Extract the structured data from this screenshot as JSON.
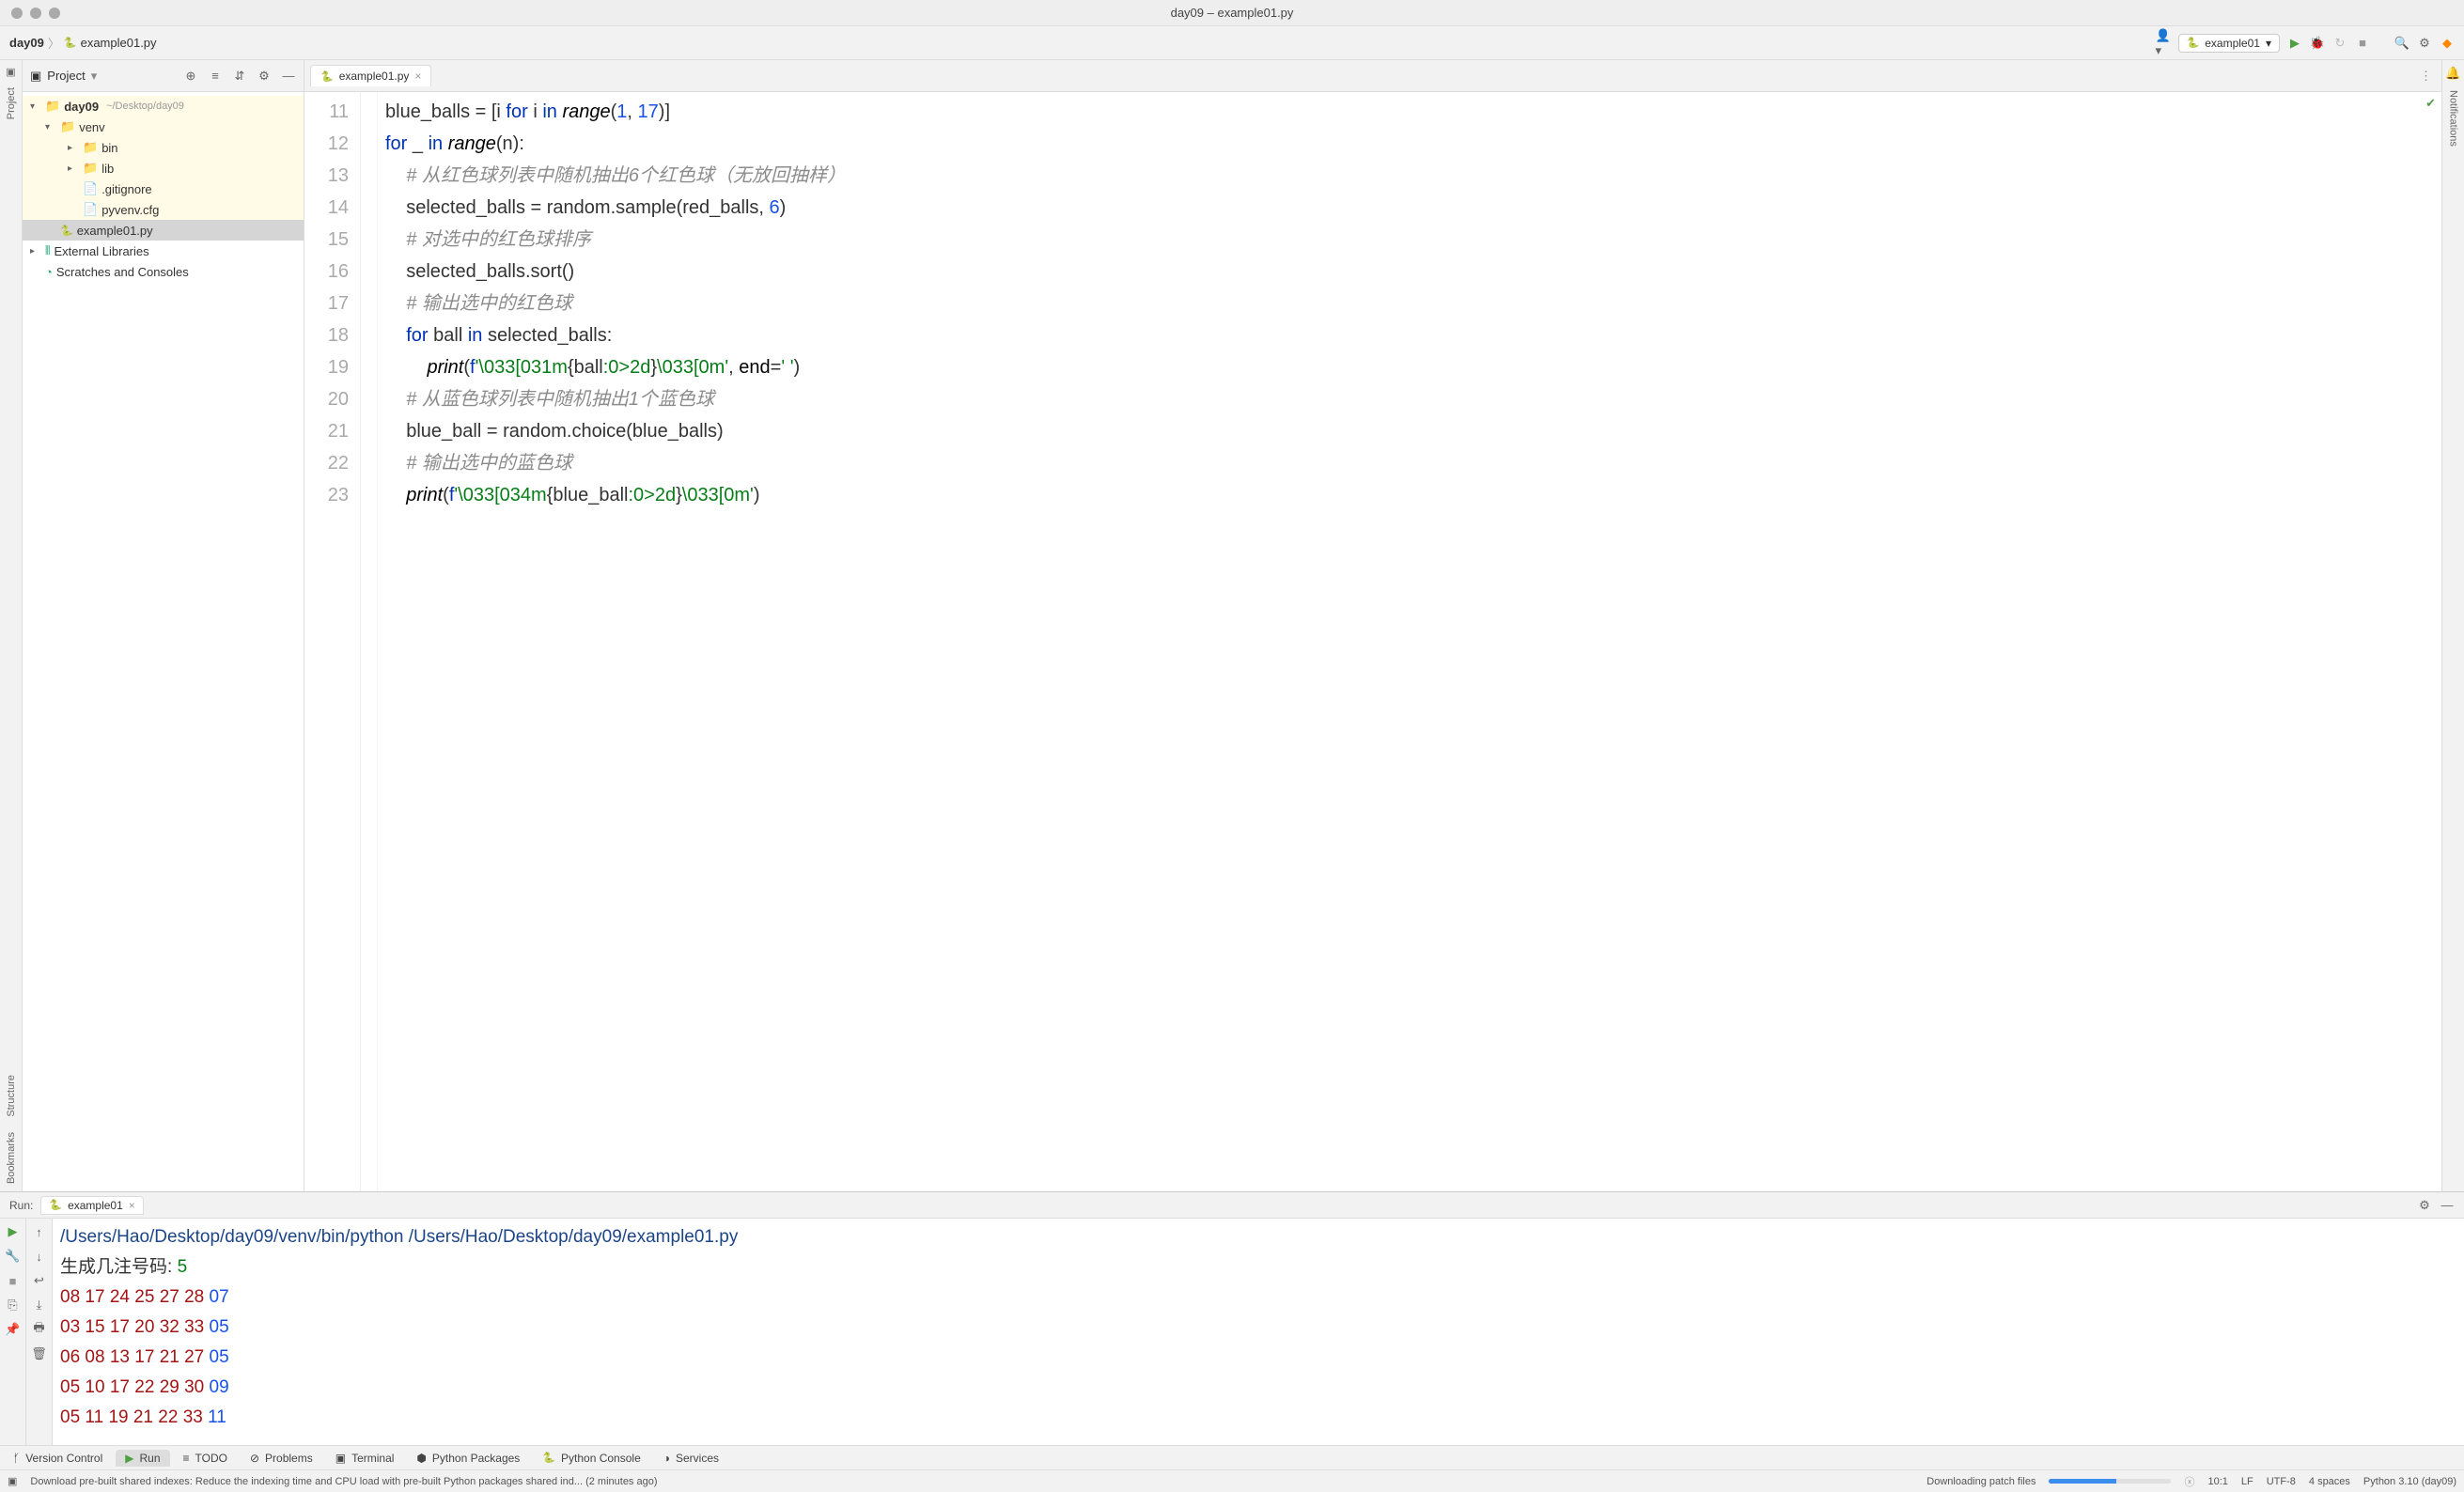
{
  "window": {
    "title": "day09 – example01.py"
  },
  "breadcrumbs": {
    "project": "day09",
    "file": "example01.py"
  },
  "run_config": {
    "selected": "example01"
  },
  "sidebar": {
    "title": "Project",
    "tree": {
      "root": {
        "name": "day09",
        "path": "~/Desktop/day09"
      },
      "venv": "venv",
      "bin": "bin",
      "lib": "lib",
      "gitignore": ".gitignore",
      "pyvenv": "pyvenv.cfg",
      "example": "example01.py",
      "external": "External Libraries",
      "scratches": "Scratches and Consoles"
    }
  },
  "editor": {
    "tab": "example01.py",
    "first_line": 11,
    "lines": [
      {
        "n": 11,
        "html": "blue_balls = [i <span class='kw'>for</span> i <span class='kw'>in</span> <span class='fn'>range</span>(<span class='num'>1</span>, <span class='num'>17</span>)]"
      },
      {
        "n": 12,
        "html": "<span class='kw'>for</span> _ <span class='kw'>in</span> <span class='fn'>range</span>(n):"
      },
      {
        "n": 13,
        "html": "    <span class='cm'># 从红色球列表中随机抽出6个红色球（无放回抽样）</span>"
      },
      {
        "n": 14,
        "html": "    selected_balls = random.sample(red_balls, <span class='num'>6</span>)"
      },
      {
        "n": 15,
        "html": "    <span class='cm'># 对选中的红色球排序</span>"
      },
      {
        "n": 16,
        "html": "    selected_balls.sort()"
      },
      {
        "n": 17,
        "html": "    <span class='cm'># 输出选中的红色球</span>"
      },
      {
        "n": 18,
        "html": "    <span class='kw'>for</span> ball <span class='kw'>in</span> selected_balls:"
      },
      {
        "n": 19,
        "html": "        <span class='fn'>print</span>(<span class='fs'>f</span><span class='str'>'\\033[031m</span>{ball<span class='str'>:0&gt;2d</span>}<span class='str'>\\033[0m'</span>, <span class='id'>end</span>=<span class='str'>' '</span>)"
      },
      {
        "n": 20,
        "html": "    <span class='cm'># 从蓝色球列表中随机抽出1个蓝色球</span>"
      },
      {
        "n": 21,
        "html": "    blue_ball = random.choice(blue_balls)"
      },
      {
        "n": 22,
        "html": "    <span class='cm'># 输出选中的蓝色球</span>"
      },
      {
        "n": 23,
        "html": "    <span class='fn'>print</span>(<span class='fs'>f</span><span class='str'>'\\033[034m</span>{blue_ball<span class='str'>:0&gt;2d</span>}<span class='str'>\\033[0m'</span>)"
      }
    ]
  },
  "run": {
    "label": "Run:",
    "tab": "example01",
    "command": "/Users/Hao/Desktop/day09/venv/bin/python /Users/Hao/Desktop/day09/example01.py",
    "prompt": "生成几注号码: ",
    "prompt_input": "5",
    "results": [
      {
        "red": [
          "08",
          "17",
          "24",
          "25",
          "27",
          "28"
        ],
        "blue": "07"
      },
      {
        "red": [
          "03",
          "15",
          "17",
          "20",
          "32",
          "33"
        ],
        "blue": "05"
      },
      {
        "red": [
          "06",
          "08",
          "13",
          "17",
          "21",
          "27"
        ],
        "blue": "05"
      },
      {
        "red": [
          "05",
          "10",
          "17",
          "22",
          "29",
          "30"
        ],
        "blue": "09"
      },
      {
        "red": [
          "05",
          "11",
          "19",
          "21",
          "22",
          "33"
        ],
        "blue": "11"
      }
    ]
  },
  "bottom_tabs": {
    "vc": "Version Control",
    "run": "Run",
    "todo": "TODO",
    "problems": "Problems",
    "terminal": "Terminal",
    "pypack": "Python Packages",
    "pycon": "Python Console",
    "services": "Services"
  },
  "status": {
    "msg": "Download pre-built shared indexes: Reduce the indexing time and CPU load with pre-built Python packages shared ind... (2 minutes ago)",
    "dl": "Downloading patch files",
    "pos": "10:1",
    "lf": "LF",
    "enc": "UTF-8",
    "indent": "4 spaces",
    "sdk": "Python 3.10 (day09)"
  },
  "vbar_left": {
    "project": "Project",
    "bookmarks": "Bookmarks",
    "structure": "Structure"
  },
  "vbar_right": {
    "notifications": "Notifications"
  }
}
